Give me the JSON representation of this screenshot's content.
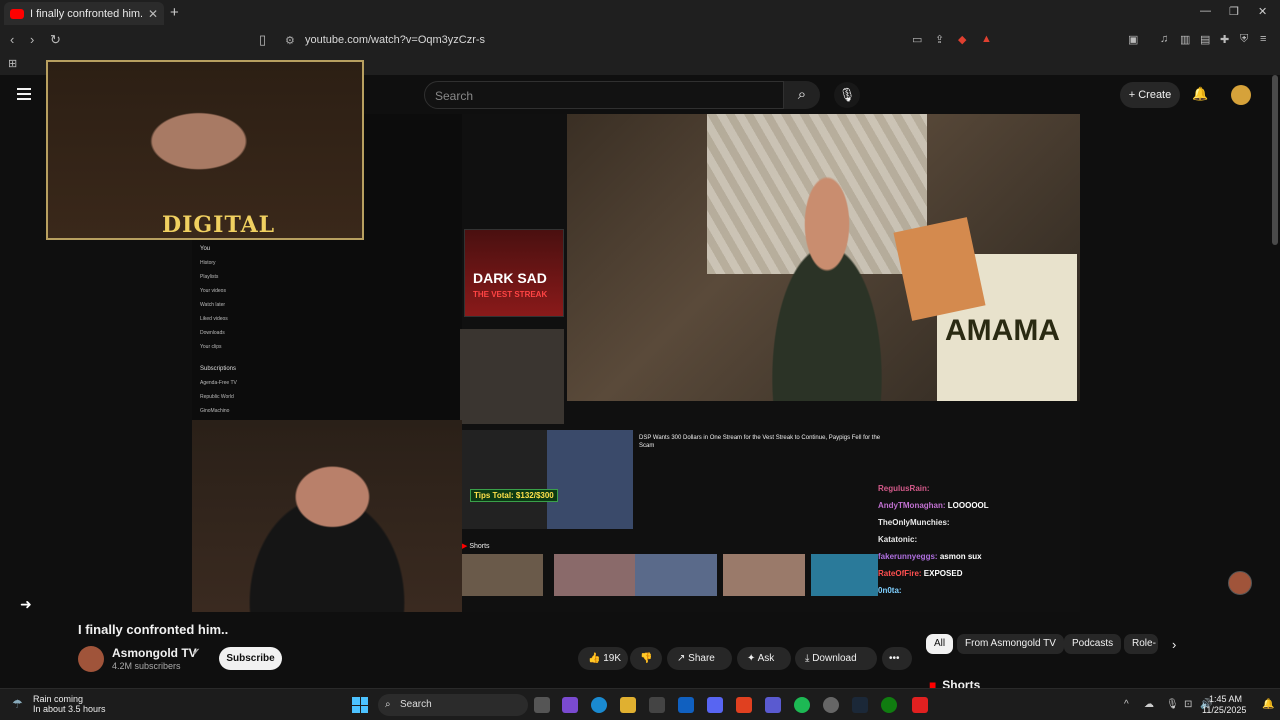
{
  "browser": {
    "tab_title": "I finally confronted him... - YouTube",
    "new_tab": "+",
    "url": "youtube.com/watch?v=Oqm3yzCzr-s"
  },
  "header": {
    "search_placeholder": "Search",
    "create_label": "Create"
  },
  "embedded": {
    "sidebar": {
      "you": "You",
      "items": [
        "History",
        "Playlists",
        "Your videos",
        "Watch later",
        "Liked videos",
        "Downloads",
        "Your clips"
      ],
      "subscriptions": "Subscriptions",
      "subs": [
        "Agenda-Free TV",
        "Republic World",
        "GinoMachino"
      ]
    },
    "thumb_title_line1": "THE",
    "thumb_title_line2": "DARK SAD",
    "thumb_title_line3": "THE VEST STREAK",
    "video_meta_title": "DSP Wants 300 Dollars in One Stream for the Vest Streak to Continue, Paypigs Fell for the Scam",
    "tips": "Tips Total: $132/$300",
    "shorts": "Shorts",
    "overlay_brand": "DIGITAL",
    "shirt_text": "AMAMA",
    "chat": [
      {
        "name": "RegulusRain:",
        "msg": ""
      },
      {
        "name": "AndyTMonaghan:",
        "msg": "LOOOOOL"
      },
      {
        "name": "TheOnlyMunchies:",
        "msg": ""
      },
      {
        "name": "Katatonic:",
        "msg": ""
      },
      {
        "name": "fakerunnyeggs:",
        "msg": "asmon sux"
      },
      {
        "name": "RateOfFire:",
        "msg": "EXPOSED"
      },
      {
        "name": "0n0ta:",
        "msg": ""
      }
    ]
  },
  "video": {
    "title": "I finally confronted him..",
    "channel": "Asmongold TV",
    "subscribers": "4.2M subscribers",
    "subscribe": "Subscribe",
    "likes": "19K",
    "share": "Share",
    "ask": "Ask",
    "download": "Download",
    "more": "•••"
  },
  "chips": [
    "All",
    "From Asmongold TV",
    "Podcasts",
    "Role-"
  ],
  "shorts_heading": "Shorts",
  "taskbar": {
    "weather_title": "Rain coming",
    "weather_sub": "In about 3.5 hours",
    "search": "Search",
    "time": "1:45 AM",
    "date": "11/25/2025"
  },
  "colors": {
    "bg": "#0f0f0f",
    "accent": "#ff0000",
    "chip_active": "#f1f1f1"
  }
}
